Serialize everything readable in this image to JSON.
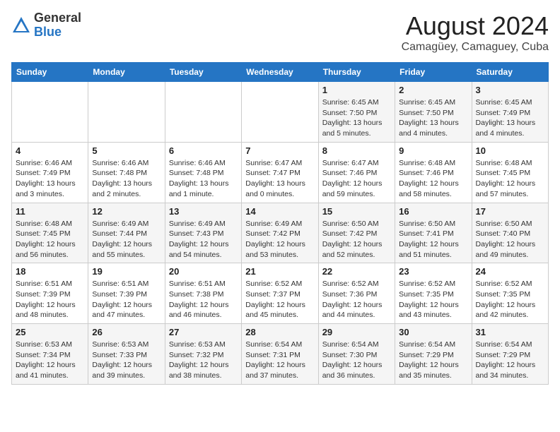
{
  "logo": {
    "general": "General",
    "blue": "Blue"
  },
  "header": {
    "month_year": "August 2024",
    "location": "Camagüey, Camaguey, Cuba"
  },
  "weekdays": [
    "Sunday",
    "Monday",
    "Tuesday",
    "Wednesday",
    "Thursday",
    "Friday",
    "Saturday"
  ],
  "weeks": [
    [
      {
        "day": "",
        "info": ""
      },
      {
        "day": "",
        "info": ""
      },
      {
        "day": "",
        "info": ""
      },
      {
        "day": "",
        "info": ""
      },
      {
        "day": "1",
        "info": "Sunrise: 6:45 AM\nSunset: 7:50 PM\nDaylight: 13 hours and 5 minutes."
      },
      {
        "day": "2",
        "info": "Sunrise: 6:45 AM\nSunset: 7:50 PM\nDaylight: 13 hours and 4 minutes."
      },
      {
        "day": "3",
        "info": "Sunrise: 6:45 AM\nSunset: 7:49 PM\nDaylight: 13 hours and 4 minutes."
      }
    ],
    [
      {
        "day": "4",
        "info": "Sunrise: 6:46 AM\nSunset: 7:49 PM\nDaylight: 13 hours and 3 minutes."
      },
      {
        "day": "5",
        "info": "Sunrise: 6:46 AM\nSunset: 7:48 PM\nDaylight: 13 hours and 2 minutes."
      },
      {
        "day": "6",
        "info": "Sunrise: 6:46 AM\nSunset: 7:48 PM\nDaylight: 13 hours and 1 minute."
      },
      {
        "day": "7",
        "info": "Sunrise: 6:47 AM\nSunset: 7:47 PM\nDaylight: 13 hours and 0 minutes."
      },
      {
        "day": "8",
        "info": "Sunrise: 6:47 AM\nSunset: 7:46 PM\nDaylight: 12 hours and 59 minutes."
      },
      {
        "day": "9",
        "info": "Sunrise: 6:48 AM\nSunset: 7:46 PM\nDaylight: 12 hours and 58 minutes."
      },
      {
        "day": "10",
        "info": "Sunrise: 6:48 AM\nSunset: 7:45 PM\nDaylight: 12 hours and 57 minutes."
      }
    ],
    [
      {
        "day": "11",
        "info": "Sunrise: 6:48 AM\nSunset: 7:45 PM\nDaylight: 12 hours and 56 minutes."
      },
      {
        "day": "12",
        "info": "Sunrise: 6:49 AM\nSunset: 7:44 PM\nDaylight: 12 hours and 55 minutes."
      },
      {
        "day": "13",
        "info": "Sunrise: 6:49 AM\nSunset: 7:43 PM\nDaylight: 12 hours and 54 minutes."
      },
      {
        "day": "14",
        "info": "Sunrise: 6:49 AM\nSunset: 7:42 PM\nDaylight: 12 hours and 53 minutes."
      },
      {
        "day": "15",
        "info": "Sunrise: 6:50 AM\nSunset: 7:42 PM\nDaylight: 12 hours and 52 minutes."
      },
      {
        "day": "16",
        "info": "Sunrise: 6:50 AM\nSunset: 7:41 PM\nDaylight: 12 hours and 51 minutes."
      },
      {
        "day": "17",
        "info": "Sunrise: 6:50 AM\nSunset: 7:40 PM\nDaylight: 12 hours and 49 minutes."
      }
    ],
    [
      {
        "day": "18",
        "info": "Sunrise: 6:51 AM\nSunset: 7:39 PM\nDaylight: 12 hours and 48 minutes."
      },
      {
        "day": "19",
        "info": "Sunrise: 6:51 AM\nSunset: 7:39 PM\nDaylight: 12 hours and 47 minutes."
      },
      {
        "day": "20",
        "info": "Sunrise: 6:51 AM\nSunset: 7:38 PM\nDaylight: 12 hours and 46 minutes."
      },
      {
        "day": "21",
        "info": "Sunrise: 6:52 AM\nSunset: 7:37 PM\nDaylight: 12 hours and 45 minutes."
      },
      {
        "day": "22",
        "info": "Sunrise: 6:52 AM\nSunset: 7:36 PM\nDaylight: 12 hours and 44 minutes."
      },
      {
        "day": "23",
        "info": "Sunrise: 6:52 AM\nSunset: 7:35 PM\nDaylight: 12 hours and 43 minutes."
      },
      {
        "day": "24",
        "info": "Sunrise: 6:52 AM\nSunset: 7:35 PM\nDaylight: 12 hours and 42 minutes."
      }
    ],
    [
      {
        "day": "25",
        "info": "Sunrise: 6:53 AM\nSunset: 7:34 PM\nDaylight: 12 hours and 41 minutes."
      },
      {
        "day": "26",
        "info": "Sunrise: 6:53 AM\nSunset: 7:33 PM\nDaylight: 12 hours and 39 minutes."
      },
      {
        "day": "27",
        "info": "Sunrise: 6:53 AM\nSunset: 7:32 PM\nDaylight: 12 hours and 38 minutes."
      },
      {
        "day": "28",
        "info": "Sunrise: 6:54 AM\nSunset: 7:31 PM\nDaylight: 12 hours and 37 minutes."
      },
      {
        "day": "29",
        "info": "Sunrise: 6:54 AM\nSunset: 7:30 PM\nDaylight: 12 hours and 36 minutes."
      },
      {
        "day": "30",
        "info": "Sunrise: 6:54 AM\nSunset: 7:29 PM\nDaylight: 12 hours and 35 minutes."
      },
      {
        "day": "31",
        "info": "Sunrise: 6:54 AM\nSunset: 7:29 PM\nDaylight: 12 hours and 34 minutes."
      }
    ]
  ]
}
